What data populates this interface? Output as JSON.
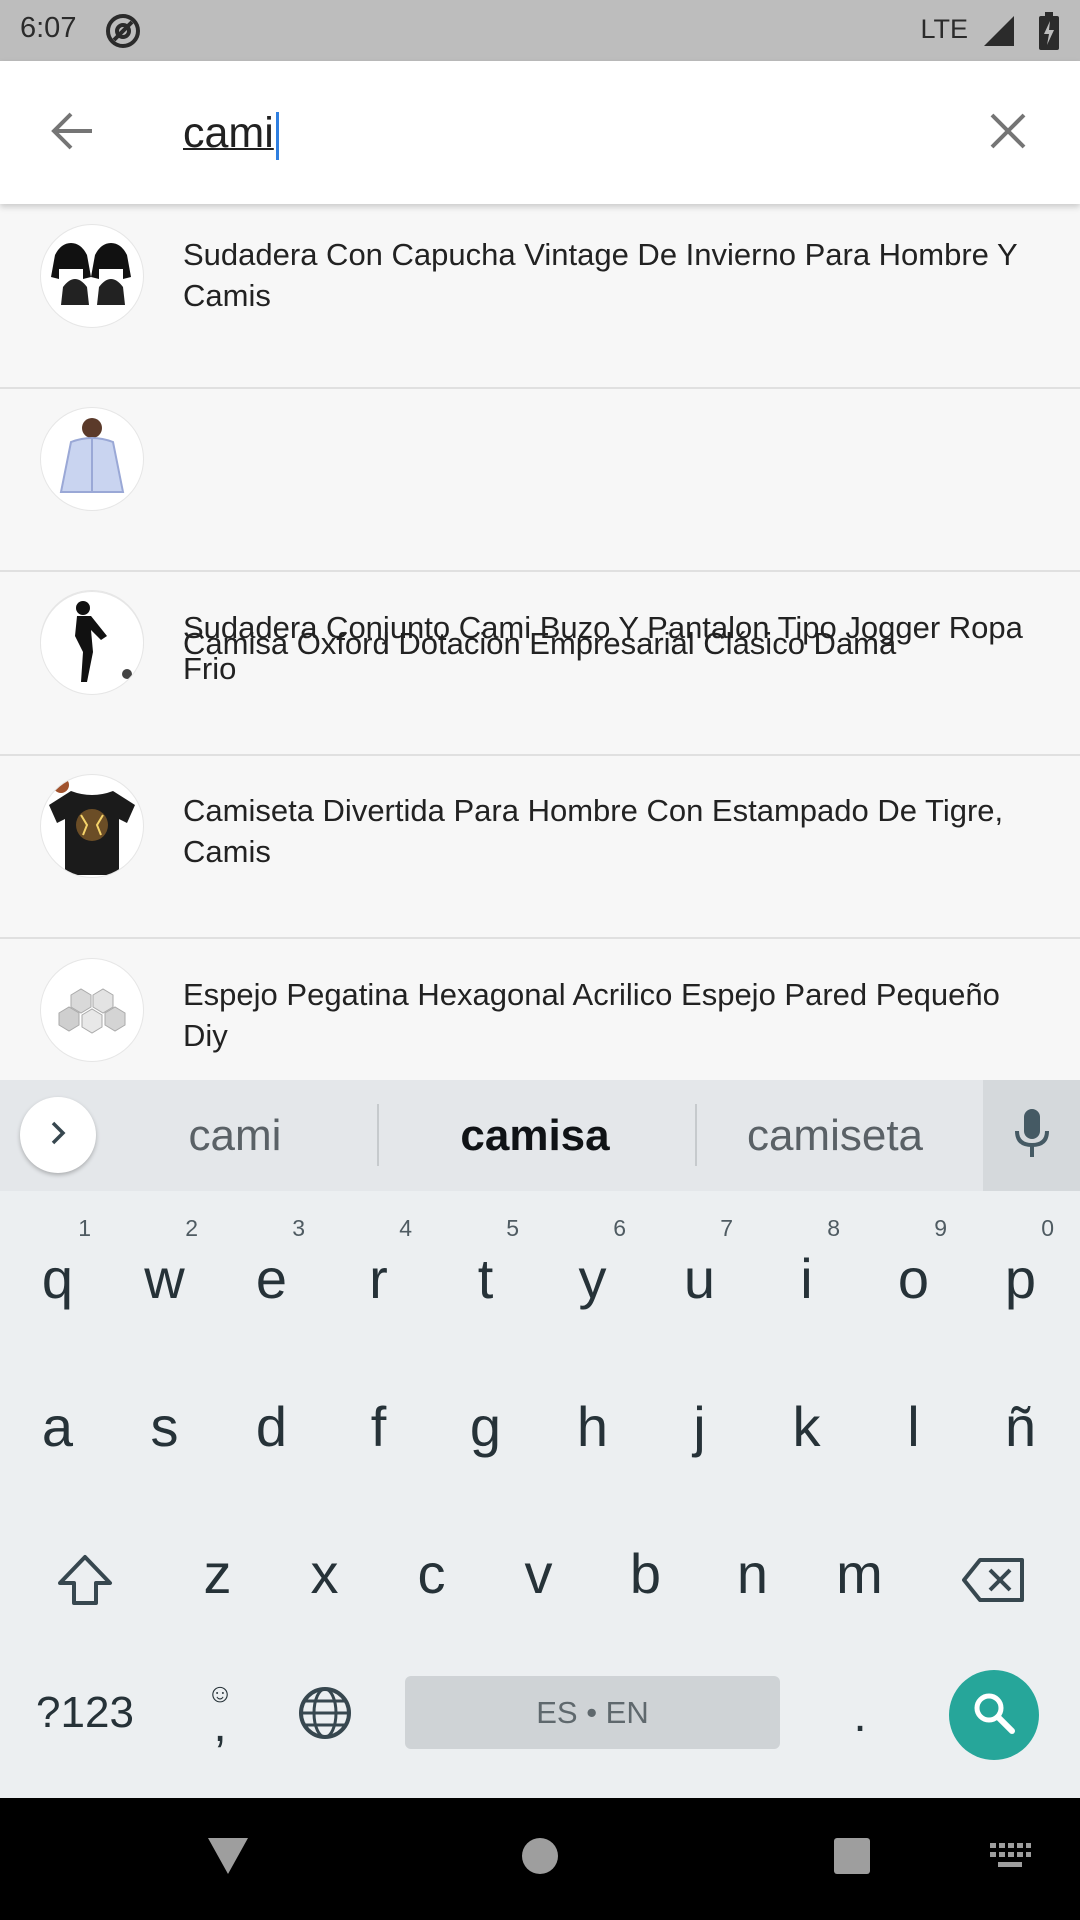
{
  "status_bar": {
    "time": "6:07",
    "network": "LTE"
  },
  "search": {
    "query": "cami",
    "back_icon": "arrow-back-icon",
    "clear_icon": "close-icon"
  },
  "results": [
    {
      "title": "Sudadera Con Capucha Vintage De Invierno Para Hombre Y Camis",
      "thumb": "black-hoodies"
    },
    {
      "title": "Camisa Oxford Dotacion Empresarial Clásico Dama",
      "thumb": "white-shirt-woman"
    },
    {
      "title": "Sudadera Conjunto Cami Buzo Y Pantalon Tipo Jogger Ropa Frio",
      "thumb": "black-tracksuit"
    },
    {
      "title": "Camiseta Divertida Para Hombre Con Estampado De Tigre, Camis",
      "thumb": "tiger-tshirt"
    },
    {
      "title": "Espejo Pegatina Hexagonal Acrilico Espejo Pared Pequeño Diy",
      "thumb": "hexagon-mirrors"
    }
  ],
  "keyboard": {
    "suggestions": [
      "cami",
      "camisa",
      "camiseta"
    ],
    "bold_suggestion_index": 1,
    "row1": [
      {
        "key": "q",
        "hint": "1"
      },
      {
        "key": "w",
        "hint": "2"
      },
      {
        "key": "e",
        "hint": "3"
      },
      {
        "key": "r",
        "hint": "4"
      },
      {
        "key": "t",
        "hint": "5"
      },
      {
        "key": "y",
        "hint": "6"
      },
      {
        "key": "u",
        "hint": "7"
      },
      {
        "key": "i",
        "hint": "8"
      },
      {
        "key": "o",
        "hint": "9"
      },
      {
        "key": "p",
        "hint": "0"
      }
    ],
    "row2": [
      "a",
      "s",
      "d",
      "f",
      "g",
      "h",
      "j",
      "k",
      "l",
      "ñ"
    ],
    "row3": [
      "z",
      "x",
      "c",
      "v",
      "b",
      "n",
      "m"
    ],
    "symbols_label": "?123",
    "comma_label": ",",
    "period_label": ".",
    "space_label": "ES • EN",
    "accent_color": "#26a69a"
  },
  "nav": {
    "back_icon": "nav-back-triangle-icon",
    "home_icon": "nav-home-circle-icon",
    "recents_icon": "nav-recents-square-icon",
    "keyboard_icon": "keyboard-switch-icon"
  }
}
